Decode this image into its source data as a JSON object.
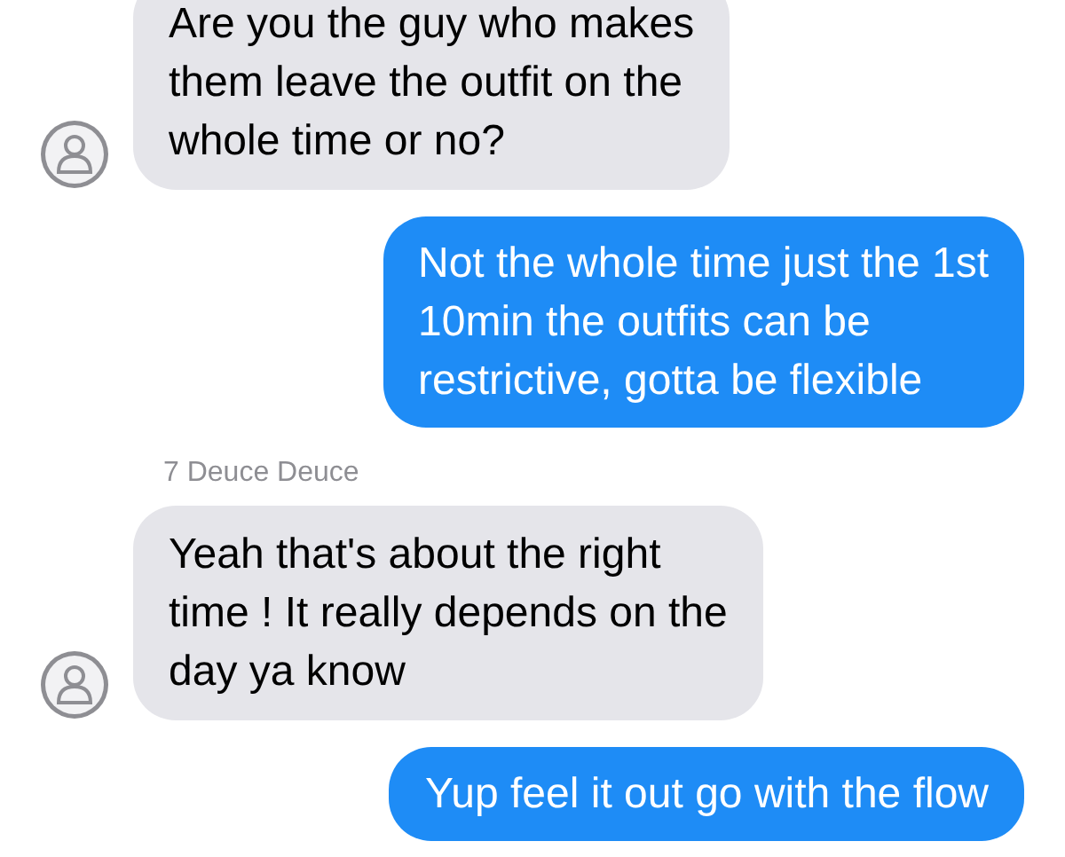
{
  "messages": [
    {
      "kind": "received",
      "text": "Are you the guy who makes\nthem leave the outfit on the\nwhole time or no?",
      "avatar": true
    },
    {
      "kind": "sent",
      "text": "Not the whole time just the 1st\n10min the outfits can be\nrestrictive, gotta be flexible"
    },
    {
      "kind": "sender",
      "text": "7 Deuce Deuce"
    },
    {
      "kind": "received",
      "text": "Yeah that's about the right\ntime ! It really depends on the\nday ya know",
      "avatar": true
    },
    {
      "kind": "sent",
      "text": "Yup feel it out go with the flow"
    }
  ]
}
